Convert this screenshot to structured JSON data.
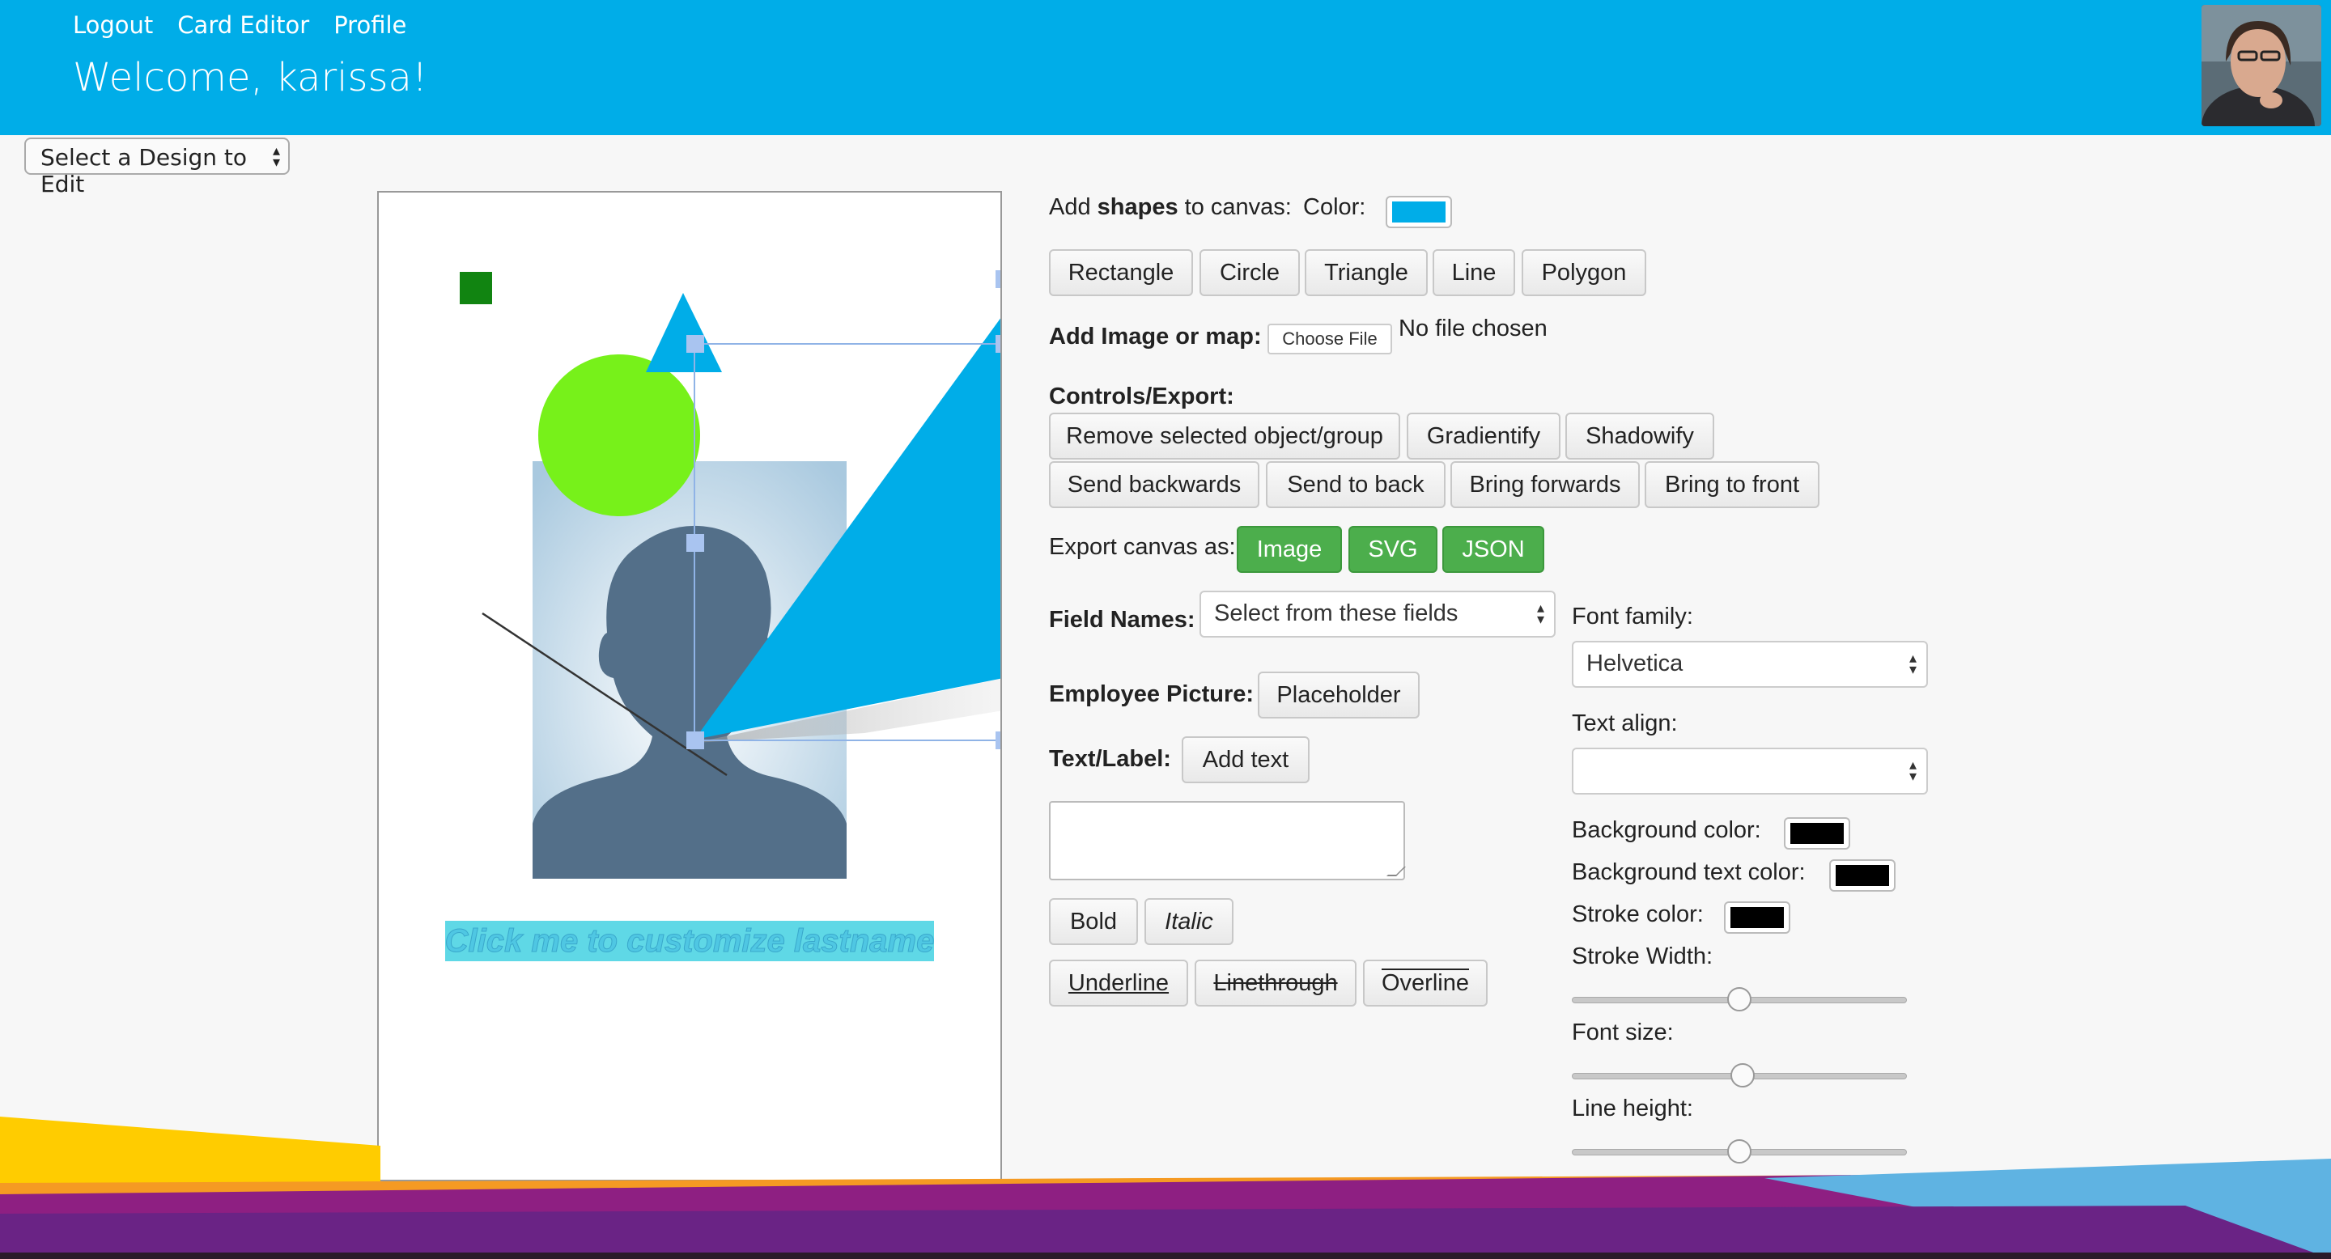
{
  "nav": {
    "logout": "Logout",
    "card_editor": "Card Editor",
    "profile": "Profile"
  },
  "welcome": "Welcome, karissa!",
  "design_select": {
    "value": "Select a Design to Edit"
  },
  "canvas": {
    "placeholder_text": "Click me to customize lastname",
    "shape_colors": {
      "square": "#118411",
      "circle": "#77f11a",
      "triangle": "#00ade8",
      "text_bg": "#5fd8e6"
    }
  },
  "shapes": {
    "label_prefix": "Add ",
    "label_bold": "shapes",
    "label_suffix": " to canvas:",
    "color_label": "Color:",
    "color_value": "#00ade8",
    "buttons": [
      "Rectangle",
      "Circle",
      "Triangle",
      "Line",
      "Polygon"
    ]
  },
  "image": {
    "label": "Add Image or map:",
    "choose_file": "Choose File",
    "no_file": "No file chosen"
  },
  "controls": {
    "label": "Controls/Export:",
    "row1": [
      "Remove selected object/group",
      "Gradientify",
      "Shadowify"
    ],
    "row2": [
      "Send backwards",
      "Send to back",
      "Bring forwards",
      "Bring to front"
    ]
  },
  "export": {
    "label": "Export canvas as:",
    "buttons": [
      "Image",
      "SVG",
      "JSON"
    ]
  },
  "field_names": {
    "label": "Field Names:",
    "select": "Select from these fields"
  },
  "employee_picture": {
    "label": "Employee Picture:",
    "button": "Placeholder"
  },
  "text_label": {
    "label": "Text/Label:",
    "button": "Add text"
  },
  "style_buttons": {
    "bold": "Bold",
    "italic": "Italic",
    "underline": "Underline",
    "linethrough": "Linethrough",
    "overline": "Overline"
  },
  "right_panel": {
    "font_family_label": "Font family:",
    "font_family_value": "Helvetica",
    "text_align_label": "Text align:",
    "text_align_value": "",
    "bg_color_label": "Background color:",
    "bg_color_value": "#000000",
    "bg_text_color_label": "Background text color:",
    "bg_text_color_value": "#000000",
    "stroke_color_label": "Stroke color:",
    "stroke_color_value": "#000000",
    "stroke_width_label": "Stroke Width:",
    "stroke_width_fraction": 0.5,
    "font_size_label": "Font size:",
    "font_size_fraction": 0.51,
    "line_height_label": "Line height:",
    "line_height_fraction": 0.5
  }
}
